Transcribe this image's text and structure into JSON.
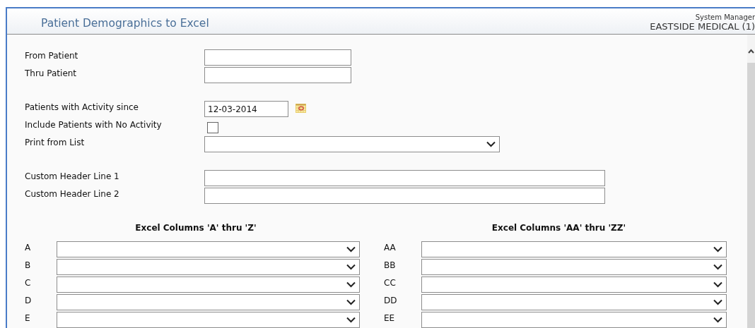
{
  "header": {
    "title": "Patient Demographics to Excel",
    "user": "System Manager",
    "practice": "EASTSIDE MEDICAL (1)"
  },
  "form": {
    "groups": [
      {
        "fields": [
          {
            "kind": "text",
            "label": "From Patient"
          },
          {
            "kind": "text",
            "label": "Thru Patient"
          }
        ]
      },
      {
        "fields": [
          {
            "kind": "date",
            "label": "Patients with Activity since",
            "value": "12-03-2014"
          },
          {
            "kind": "checkbox",
            "label": "Include Patients with No Activity",
            "checked": false
          },
          {
            "kind": "select",
            "label": "Print from List"
          }
        ]
      },
      {
        "fields": [
          {
            "kind": "wide-text",
            "label": "Custom Header Line 1"
          },
          {
            "kind": "wide-text",
            "label": "Custom Header Line 2"
          }
        ]
      }
    ]
  },
  "excel_columns": [
    {
      "heading": "Excel Columns 'A' thru 'Z'",
      "rows": [
        "A",
        "B",
        "C",
        "D",
        "E"
      ]
    },
    {
      "heading": "Excel Columns 'AA' thru 'ZZ'",
      "rows": [
        "AA",
        "BB",
        "CC",
        "DD",
        "EE"
      ]
    }
  ]
}
